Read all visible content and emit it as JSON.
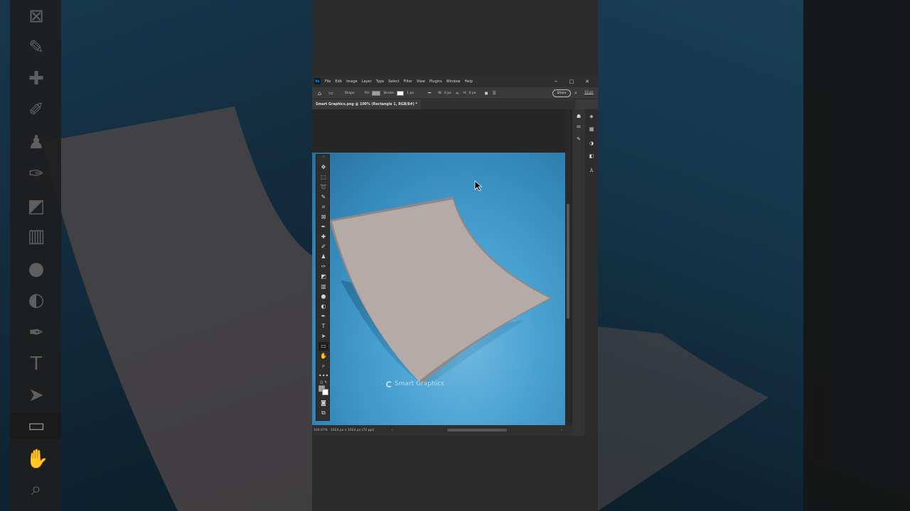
{
  "app": {
    "logo": "Ps",
    "menu": [
      "File",
      "Edit",
      "Image",
      "Layer",
      "Type",
      "Select",
      "Filter",
      "View",
      "Plugins",
      "Window",
      "Help"
    ],
    "window_controls": {
      "minimize": "─",
      "maximize": "□",
      "close": "✕"
    }
  },
  "options_bar": {
    "mode": "Shape",
    "fill_label": "Fill:",
    "fill_color": "#a69d9b",
    "stroke_label": "Stroke:",
    "stroke_width": "1 px",
    "w_label": "W:",
    "w_value": "0 px",
    "h_label": "H:",
    "h_value": "0 px",
    "share_label": "Share",
    "corner_radius": "10 px"
  },
  "document": {
    "tab_title": "Smart Graphics.png @ 100% (Rectangle 1, RGB/8#) *",
    "watermark": "Smart Graphics"
  },
  "status": {
    "zoom": "100.07%",
    "dimensions": "1024 px x 1024 px (72 ppi)",
    "nav_left": "‹",
    "nav_right": "›"
  },
  "colors": {
    "canvas_bg": "#4aa2d2",
    "paper": "#b4aaa7",
    "paper_edge": "#8f8886",
    "foreground": "#a69d9b",
    "background": "#ffffff"
  },
  "tools": [
    "move-icon",
    "marquee-icon",
    "lasso-icon",
    "quick-select-icon",
    "crop-icon",
    "frame-icon",
    "eyedropper-icon",
    "healing-brush-icon",
    "brush-icon",
    "clone-stamp-icon",
    "history-brush-icon",
    "eraser-icon",
    "gradient-icon",
    "blur-icon",
    "dodge-icon",
    "pen-icon",
    "type-icon",
    "path-select-icon",
    "rectangle-icon",
    "hand-icon",
    "zoom-icon",
    "more-tools-icon"
  ],
  "active_tool": "rectangle-icon",
  "right_panels": [
    "learn-icon",
    "properties-icon",
    "brush-settings-icon",
    "layers-icon",
    "libraries-icon",
    "adjustments-icon",
    "paths-icon",
    "people-icon"
  ]
}
